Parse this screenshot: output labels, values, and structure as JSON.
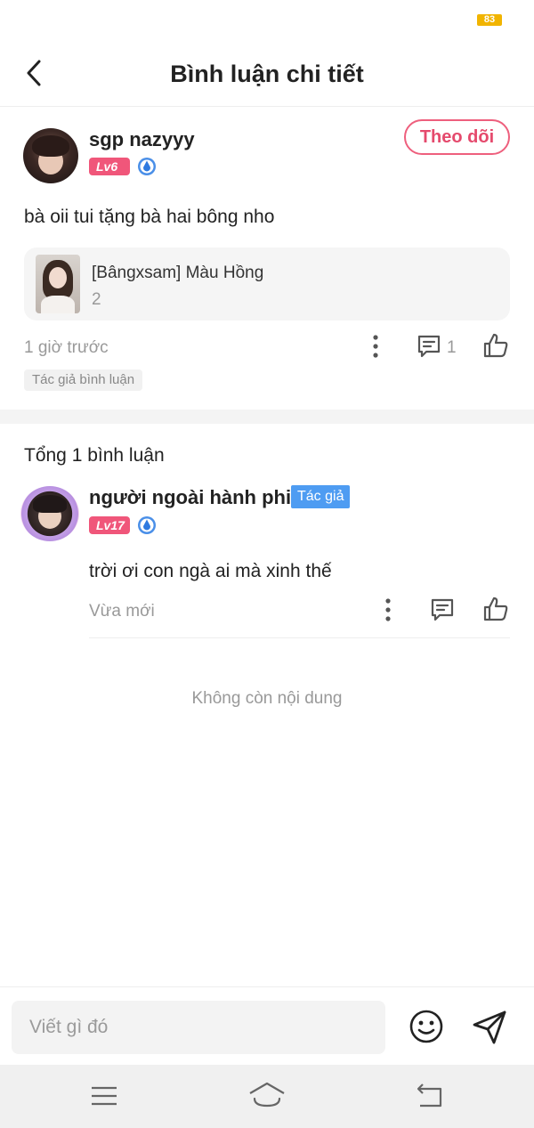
{
  "status_bar": {
    "battery_level": "83"
  },
  "header": {
    "title": "Bình luận chi tiết"
  },
  "main_comment": {
    "username": "sgp nazyyy",
    "level": "Lv6",
    "follow_label": "Theo dõi",
    "text": "bà oii tui tặng bà hai bông nho",
    "reference": {
      "title": "[Bângxsam] Màu Hồng",
      "subtitle": "2"
    },
    "time": "1 giờ trước",
    "reply_count": "1",
    "author_tag": "Tác giả bình luận"
  },
  "replies_section": {
    "total_label": "Tổng 1 bình luận",
    "replies": [
      {
        "username": "người ngoài hành phi",
        "author_badge": "Tác giả",
        "level": "Lv17",
        "text": "trời ơi con ngà ai mà xinh thế",
        "time": "Vừa mới"
      }
    ],
    "end_label": "Không còn nội dung"
  },
  "input_bar": {
    "placeholder": "Viết gì đó"
  },
  "colors": {
    "accent": "#e54a6d",
    "level_badge": "#f0567a",
    "author_badge": "#4e9cf2",
    "battery": "#f1b400"
  }
}
